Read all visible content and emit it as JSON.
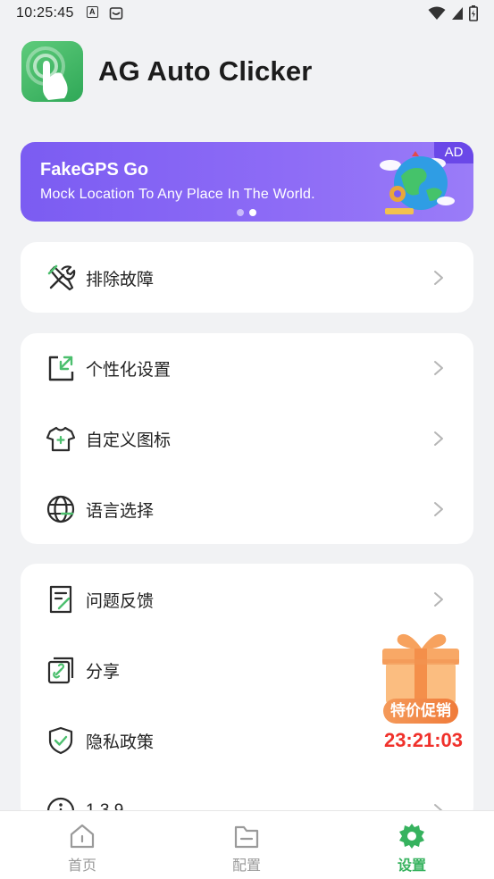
{
  "status_bar": {
    "time": "10:25:45"
  },
  "app": {
    "title": "AG Auto Clicker"
  },
  "ad": {
    "title": "FakeGPS Go",
    "subtitle": "Mock Location To Any Place In The World.",
    "tag": "AD",
    "dots": 2,
    "active_dot": 2
  },
  "menu": {
    "troubleshoot": "排除故障",
    "personalize": "个性化设置",
    "custom_icon": "自定义图标",
    "language": "语言选择",
    "feedback": "问题反馈",
    "share": "分享",
    "privacy": "隐私政策",
    "version": "1.3.9"
  },
  "promo": {
    "badge": "特价促销",
    "timer": "23:21:03"
  },
  "tabs": [
    {
      "label": "首页",
      "icon": "home-icon",
      "active": false
    },
    {
      "label": "配置",
      "icon": "folder-icon",
      "active": false
    },
    {
      "label": "设置",
      "icon": "gear-icon",
      "active": true
    }
  ],
  "colors": {
    "accent": "#36b25e",
    "ad_bg": "#8e6cf6",
    "promo_red": "#f0312b",
    "background": "#f1f2f4"
  }
}
